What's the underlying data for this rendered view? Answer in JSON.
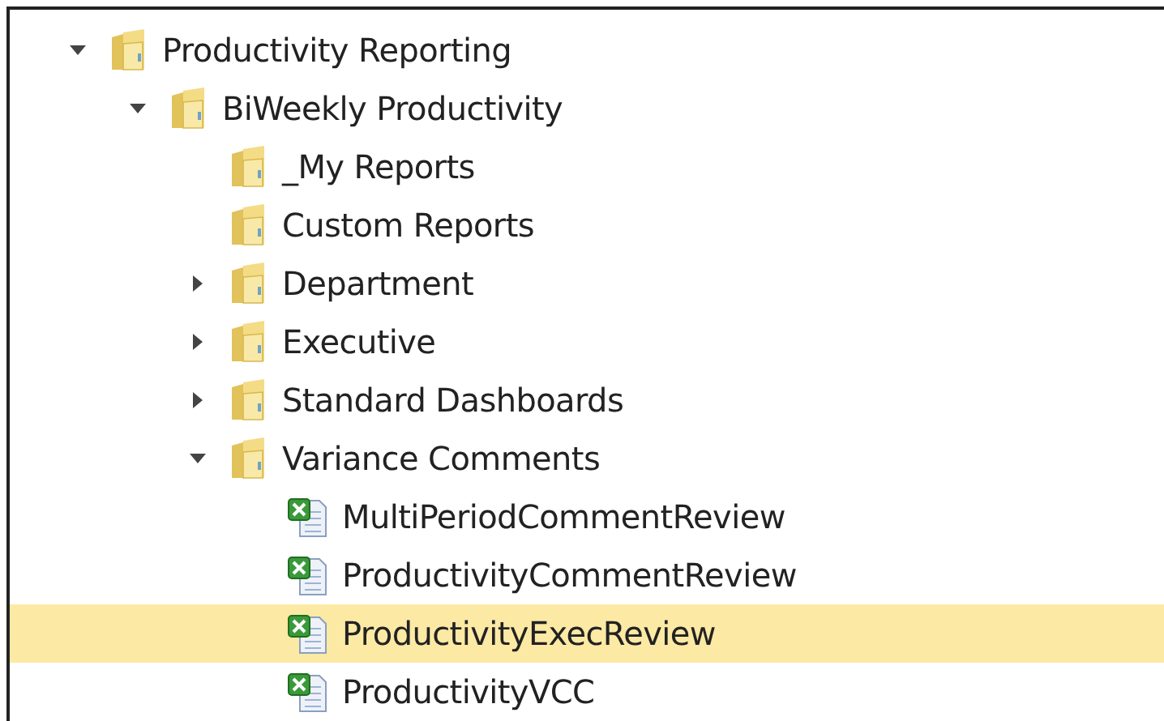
{
  "tree": [
    {
      "label": "Productivity Reporting",
      "kind": "folder",
      "expanded": true,
      "selected": false,
      "children": [
        {
          "label": "BiWeekly Productivity",
          "kind": "folder",
          "expanded": true,
          "selected": false,
          "children": [
            {
              "label": "_My Reports",
              "kind": "folder",
              "selected": false
            },
            {
              "label": "Custom Reports",
              "kind": "folder",
              "selected": false
            },
            {
              "label": "Department",
              "kind": "folder",
              "expanded": false,
              "selected": false
            },
            {
              "label": "Executive",
              "kind": "folder",
              "expanded": false,
              "selected": false
            },
            {
              "label": "Standard Dashboards",
              "kind": "folder",
              "expanded": false,
              "selected": false
            },
            {
              "label": "Variance Comments",
              "kind": "folder",
              "expanded": true,
              "selected": false,
              "children": [
                {
                  "label": "MultiPeriodCommentReview",
                  "kind": "file",
                  "selected": false
                },
                {
                  "label": "ProductivityCommentReview",
                  "kind": "file",
                  "selected": false
                },
                {
                  "label": "ProductivityExecReview",
                  "kind": "file",
                  "selected": true
                },
                {
                  "label": "ProductivityVCC",
                  "kind": "file",
                  "selected": false
                }
              ]
            }
          ]
        }
      ]
    }
  ]
}
